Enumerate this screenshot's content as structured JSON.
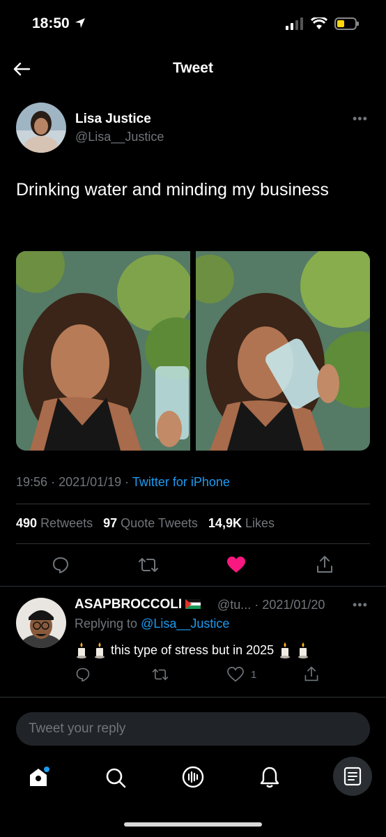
{
  "status_bar": {
    "time": "18:50"
  },
  "header": {
    "title": "Tweet"
  },
  "tweet": {
    "author_name": "Lisa Justice",
    "author_handle": "@Lisa__Justice",
    "text": "Drinking water and minding my business",
    "time": "19:56",
    "date": "2021/01/19",
    "source": "Twitter for iPhone",
    "retweets_count": "490",
    "retweets_label": "Retweets",
    "quotes_count": "97",
    "quotes_label": "Quote Tweets",
    "likes_count": "14,9K",
    "likes_label": "Likes",
    "liked": true
  },
  "reply": {
    "author_name": "ASAPBROCCOLI",
    "author_handle": "@tu...",
    "date": "2021/01/20",
    "replying_prefix": "Replying to",
    "replying_to": "@Lisa__Justice",
    "text_main": "this type of stress but in 2025",
    "likes_count": "1"
  },
  "composer": {
    "placeholder": "Tweet your reply"
  },
  "colors": {
    "accent": "#1d9bf0",
    "like": "#f91880",
    "background": "#000000"
  },
  "icons": [
    "back-arrow-icon",
    "more-icon",
    "reply-icon",
    "retweet-icon",
    "heart-icon",
    "share-icon",
    "home-icon",
    "search-icon",
    "spaces-icon",
    "bell-icon",
    "messages-icon",
    "candle-icon",
    "palestine-flag-icon"
  ]
}
